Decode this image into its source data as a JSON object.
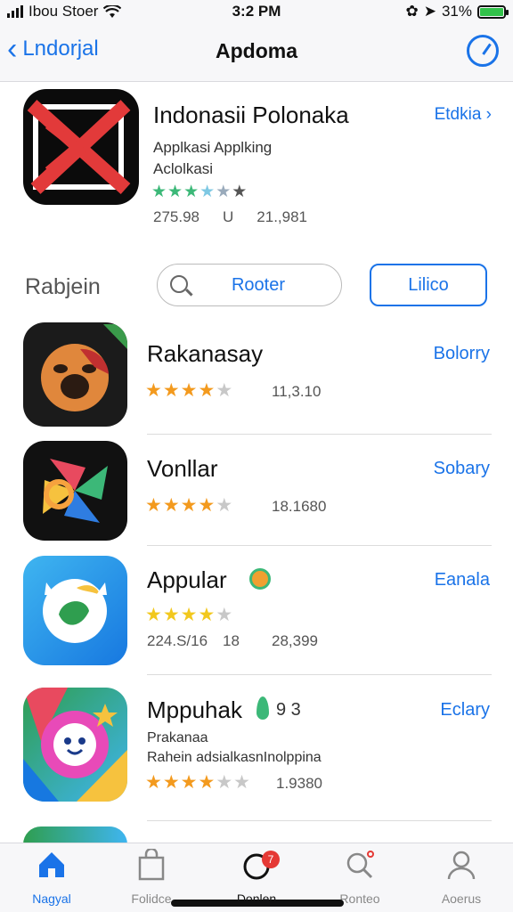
{
  "status_bar": {
    "carrier": "Ibou Stoer",
    "time": "3:2 PM",
    "battery": "31%"
  },
  "nav": {
    "back_label": "Lndorjal",
    "title": "Apdoma"
  },
  "featured": {
    "name": "Indonasii Polonaka",
    "subtitle1": "Applkasi Applking",
    "subtitle2": "Aclolkasi",
    "meta1": "275.98",
    "meta2": "U",
    "meta3": "21.,981",
    "link": "Etdkia",
    "rating_stars": 4
  },
  "section": {
    "title": "Rabjein",
    "search_label": "Rooter",
    "button_label": "Lilico"
  },
  "apps": [
    {
      "name": "Rakanasay",
      "action": "Bolorry",
      "meta": "11,3.10",
      "rating_stars": 4
    },
    {
      "name": "Vonllar",
      "action": "Sobary",
      "meta": "18.1680",
      "rating_stars": 4
    },
    {
      "name": "Appular",
      "action": "Eanala",
      "meta_left": "224.S/16",
      "meta_mid": "18",
      "meta": "28,399",
      "rating_stars": 4
    },
    {
      "name": "Mppuhak",
      "name_suffix": "9 3",
      "action": "Eclary",
      "sub1": "Prakanaa",
      "sub2": "Rahein adsialkasnInolppina",
      "meta": "1.9380",
      "rating_stars": 4
    }
  ],
  "tabs": [
    {
      "label": "Nagyal"
    },
    {
      "label": "Folidce"
    },
    {
      "label": "Donlen",
      "badge": "7"
    },
    {
      "label": "Ronteo"
    },
    {
      "label": "Aoerus"
    }
  ],
  "colors": {
    "accent": "#1a73e8",
    "star": "#f39a1e",
    "badge": "#e53935"
  }
}
